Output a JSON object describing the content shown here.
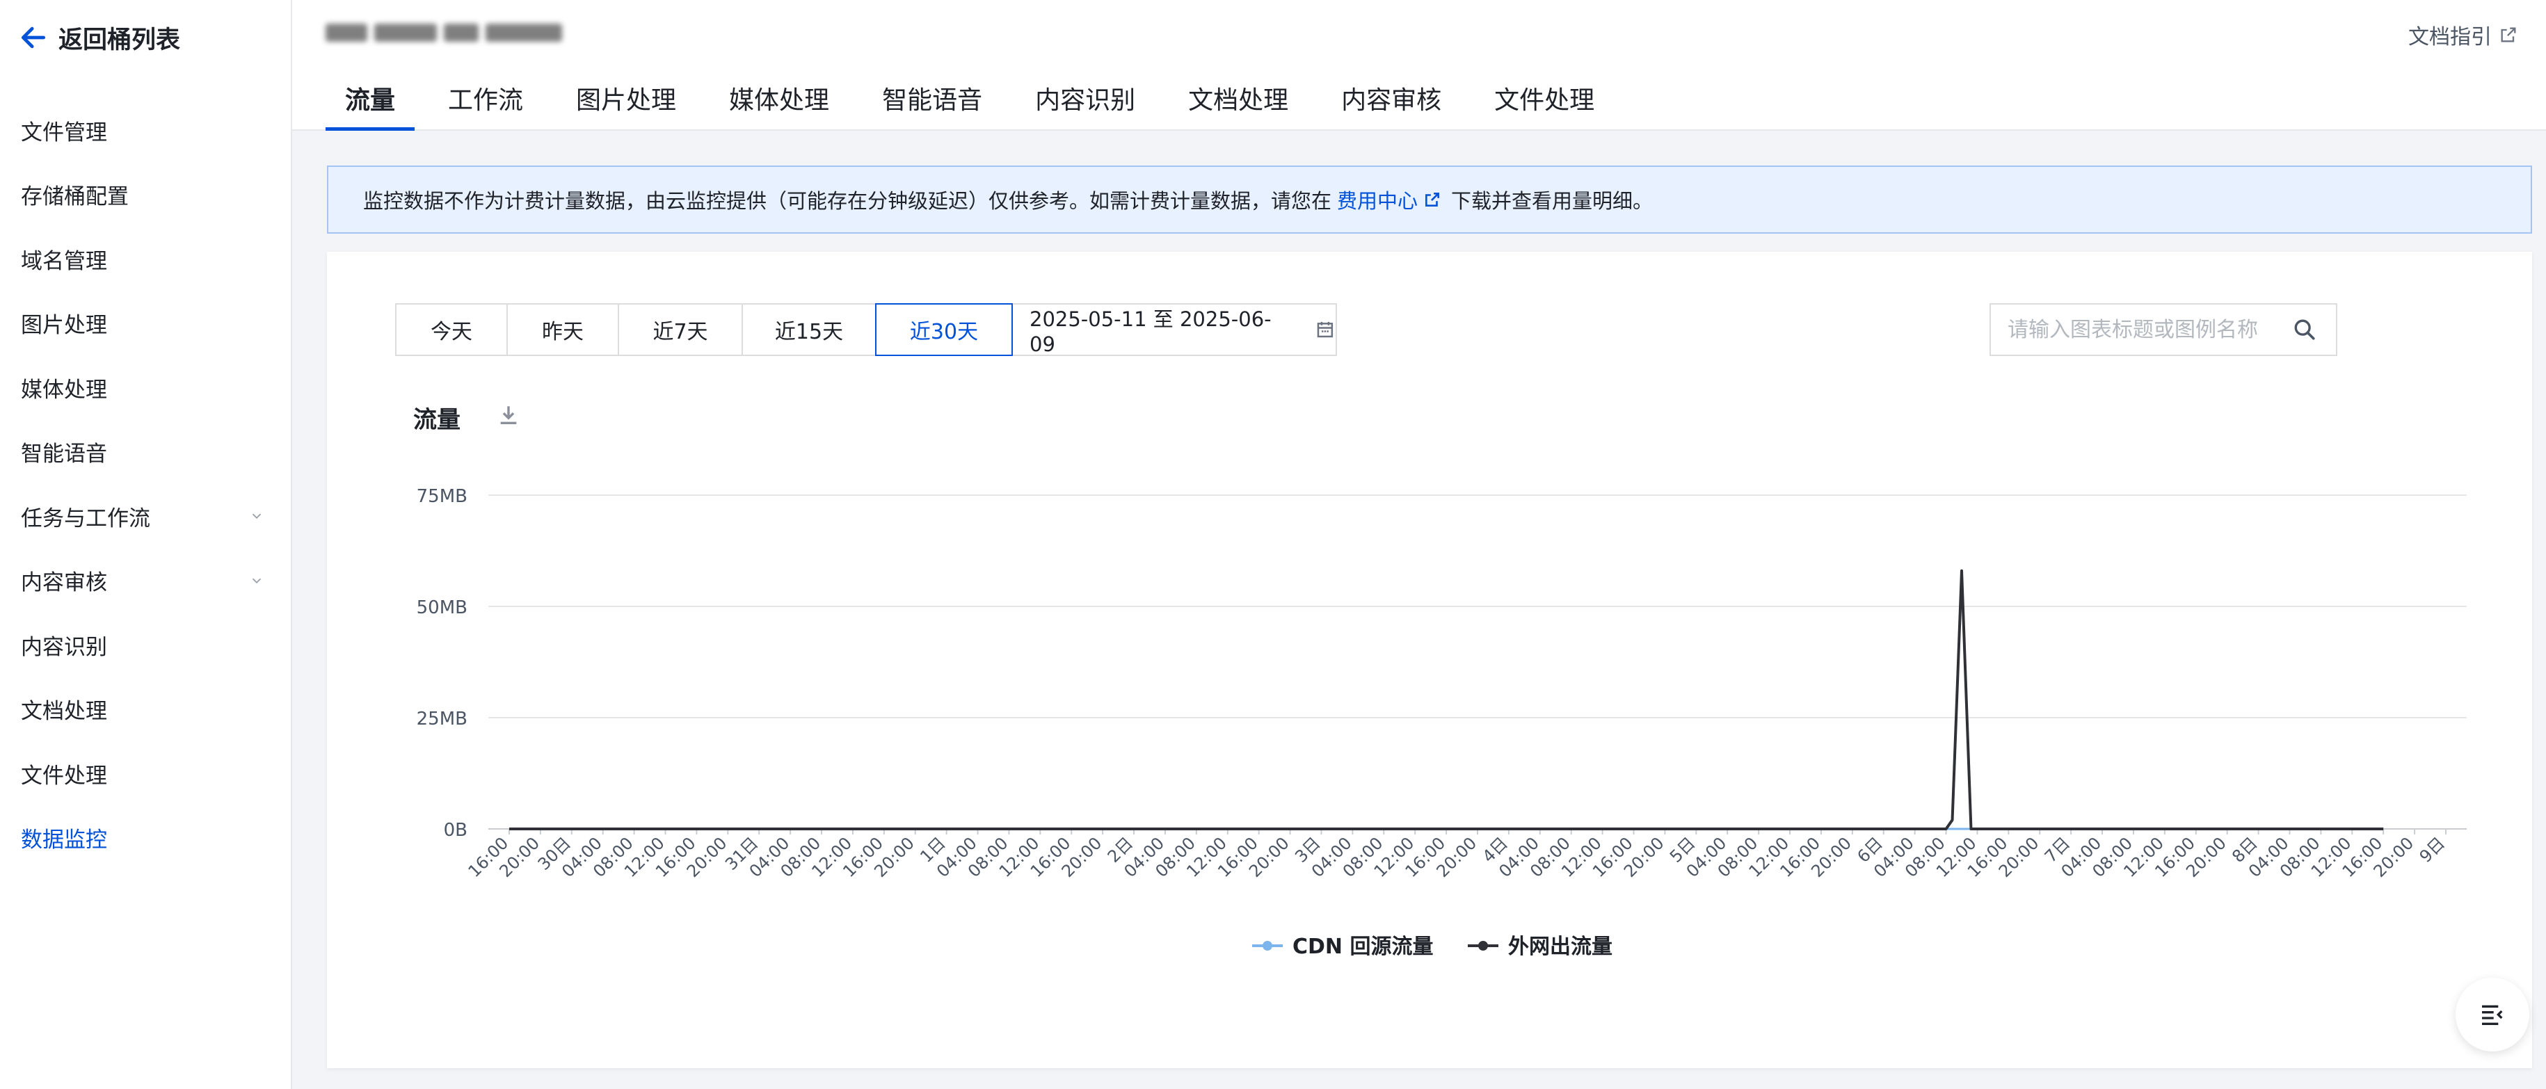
{
  "sidebar": {
    "back_label": "返回桶列表",
    "items": [
      {
        "label": "文件管理",
        "expandable": false,
        "active": false
      },
      {
        "label": "存储桶配置",
        "expandable": false,
        "active": false
      },
      {
        "label": "域名管理",
        "expandable": false,
        "active": false
      },
      {
        "label": "图片处理",
        "expandable": false,
        "active": false
      },
      {
        "label": "媒体处理",
        "expandable": false,
        "active": false
      },
      {
        "label": "智能语音",
        "expandable": false,
        "active": false
      },
      {
        "label": "任务与工作流",
        "expandable": true,
        "active": false
      },
      {
        "label": "内容审核",
        "expandable": true,
        "active": false
      },
      {
        "label": "内容识别",
        "expandable": false,
        "active": false
      },
      {
        "label": "文档处理",
        "expandable": false,
        "active": false
      },
      {
        "label": "文件处理",
        "expandable": false,
        "active": false
      },
      {
        "label": "数据监控",
        "expandable": false,
        "active": true
      }
    ]
  },
  "header": {
    "doc_guide": "文档指引",
    "tabs": [
      {
        "label": "流量",
        "active": true
      },
      {
        "label": "工作流",
        "active": false
      },
      {
        "label": "图片处理",
        "active": false
      },
      {
        "label": "媒体处理",
        "active": false
      },
      {
        "label": "智能语音",
        "active": false
      },
      {
        "label": "内容识别",
        "active": false
      },
      {
        "label": "文档处理",
        "active": false
      },
      {
        "label": "内容审核",
        "active": false
      },
      {
        "label": "文件处理",
        "active": false
      }
    ]
  },
  "notice": {
    "text_before": "监控数据不作为计费计量数据，由云监控提供（可能存在分钟级延迟）仅供参考。如需计费计量数据，请您在",
    "link": "费用中心",
    "text_after": "下载并查看用量明细。"
  },
  "filters": {
    "ranges": [
      {
        "label": "今天",
        "active": false
      },
      {
        "label": "昨天",
        "active": false
      },
      {
        "label": "近7天",
        "active": false
      },
      {
        "label": "近15天",
        "active": false
      },
      {
        "label": "近30天",
        "active": true
      }
    ],
    "date_range": "2025-05-11 至 2025-06-09",
    "search_placeholder": "请输入图表标题或图例名称"
  },
  "colors": {
    "accent": "#0052d9",
    "series_cdn": "#7cb4ec",
    "series_internet": "#2f3136"
  },
  "chart_data": {
    "type": "line",
    "title": "流量",
    "y_ticks": [
      "0B",
      "25MB",
      "50MB",
      "75MB"
    ],
    "ylim": [
      0,
      75
    ],
    "y_unit": "MB",
    "x_ticks": [
      "16:00",
      "20:00",
      "30日",
      "04:00",
      "08:00",
      "12:00",
      "16:00",
      "20:00",
      "31日",
      "04:00",
      "08:00",
      "12:00",
      "16:00",
      "20:00",
      "1日",
      "04:00",
      "08:00",
      "12:00",
      "16:00",
      "20:00",
      "2日",
      "04:00",
      "08:00",
      "12:00",
      "16:00",
      "20:00",
      "3日",
      "04:00",
      "08:00",
      "12:00",
      "16:00",
      "20:00",
      "4日",
      "04:00",
      "08:00",
      "12:00",
      "16:00",
      "20:00",
      "5日",
      "04:00",
      "08:00",
      "12:00",
      "16:00",
      "20:00",
      "6日",
      "04:00",
      "08:00",
      "12:00",
      "16:00",
      "20:00",
      "7日",
      "04:00",
      "08:00",
      "12:00",
      "16:00",
      "20:00",
      "8日",
      "04:00",
      "08:00",
      "12:00",
      "16:00",
      "20:00",
      "9日"
    ],
    "series": [
      {
        "name": "CDN 回源流量",
        "color": "#7cb4ec",
        "points": [
          [
            0,
            0
          ],
          [
            60,
            0
          ]
        ]
      },
      {
        "name": "外网出流量",
        "color": "#2f3136",
        "points": [
          [
            0,
            0
          ],
          [
            46,
            0
          ],
          [
            46.2,
            2
          ],
          [
            46.5,
            58
          ],
          [
            46.8,
            0
          ],
          [
            60,
            0
          ]
        ]
      }
    ],
    "legend_position": "bottom-center",
    "grid": true
  }
}
